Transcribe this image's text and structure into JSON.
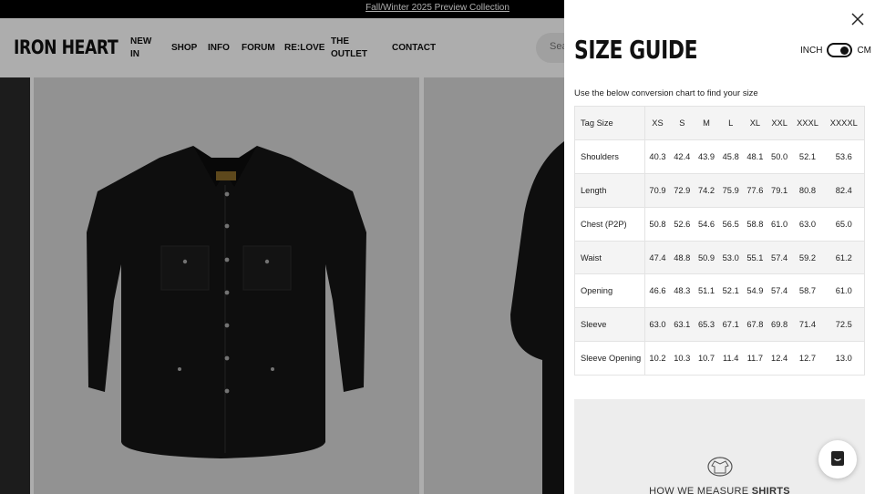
{
  "announcement": {
    "text": "Fall/Winter 2025 Preview Collection"
  },
  "header": {
    "logo": "IRON HEART",
    "nav": [
      {
        "line1": "NEW",
        "line2": "IN"
      },
      {
        "line1": "SHOP",
        "line2": ""
      },
      {
        "line1": "INFO",
        "line2": ""
      },
      {
        "line1": "FORUM",
        "line2": ""
      },
      {
        "line1": "RE:LOVE",
        "line2": ""
      },
      {
        "line1": "THE",
        "line2": "OUTLET"
      },
      {
        "line1": "CONTACT",
        "line2": ""
      }
    ],
    "search_placeholder": "Sea"
  },
  "size_guide": {
    "title": "SIZE GUIDE",
    "unit_left": "INCH",
    "unit_right": "CM",
    "selected_unit": "CM",
    "intro": "Use the below conversion chart to find your size",
    "header_label": "Tag Size",
    "sizes": [
      "XS",
      "S",
      "M",
      "L",
      "XL",
      "XXL",
      "XXXL",
      "XXXXL"
    ],
    "rows": [
      {
        "label": "Shoulders",
        "values": [
          "40.3",
          "42.4",
          "43.9",
          "45.8",
          "48.1",
          "50.0",
          "52.1",
          "53.6"
        ]
      },
      {
        "label": "Length",
        "values": [
          "70.9",
          "72.9",
          "74.2",
          "75.9",
          "77.6",
          "79.1",
          "80.8",
          "82.4"
        ]
      },
      {
        "label": "Chest (P2P)",
        "values": [
          "50.8",
          "52.6",
          "54.6",
          "56.5",
          "58.8",
          "61.0",
          "63.0",
          "65.0"
        ]
      },
      {
        "label": "Waist",
        "values": [
          "47.4",
          "48.8",
          "50.9",
          "53.0",
          "55.1",
          "57.4",
          "59.2",
          "61.2"
        ]
      },
      {
        "label": "Opening",
        "values": [
          "46.6",
          "48.3",
          "51.1",
          "52.1",
          "54.9",
          "57.4",
          "58.7",
          "61.0"
        ]
      },
      {
        "label": "Sleeve",
        "values": [
          "63.0",
          "63.1",
          "65.3",
          "67.1",
          "67.8",
          "69.8",
          "71.4",
          "72.5"
        ]
      },
      {
        "label": "Sleeve Opening",
        "values": [
          "10.2",
          "10.3",
          "10.7",
          "11.4",
          "11.7",
          "12.4",
          "12.7",
          "13.0"
        ]
      }
    ],
    "measure_caption_prefix": "HOW WE MEASURE",
    "measure_caption_item": "SHIRTS"
  },
  "icons": {
    "close": "close-icon",
    "chat": "chat-icon",
    "measure": "shirt-measure-icon"
  }
}
